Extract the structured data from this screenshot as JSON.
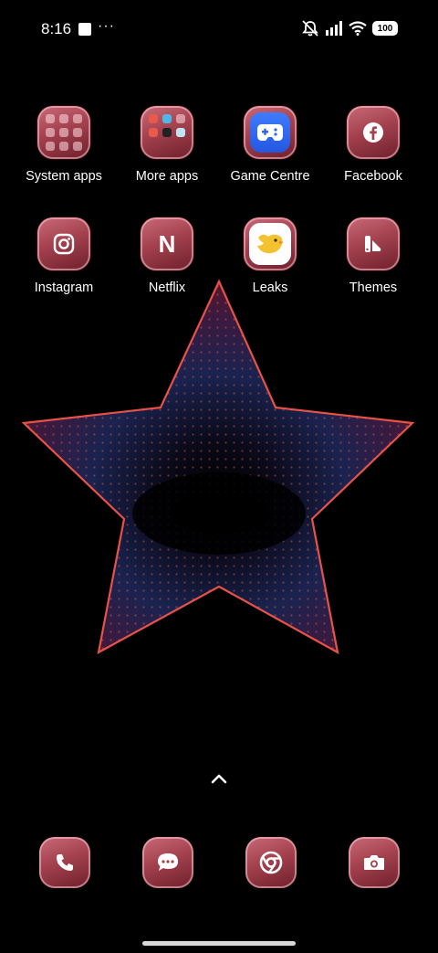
{
  "status_bar": {
    "time": "8:16",
    "more": "···",
    "battery": "100",
    "icons": [
      "notification-square-icon",
      "silent-bell-icon",
      "signal-icon",
      "wifi-icon",
      "battery-icon"
    ]
  },
  "apps": [
    {
      "label": "System apps",
      "icon": "folder-icon"
    },
    {
      "label": "More apps",
      "icon": "folder-icon"
    },
    {
      "label": "Game Centre",
      "icon": "gamepad-icon"
    },
    {
      "label": "Facebook",
      "icon": "facebook-icon"
    },
    {
      "label": "Instagram",
      "icon": "instagram-icon"
    },
    {
      "label": "Netflix",
      "icon": "netflix-icon",
      "glyph": "N"
    },
    {
      "label": "Leaks",
      "icon": "bird-icon"
    },
    {
      "label": "Themes",
      "icon": "themes-icon"
    }
  ],
  "dock": [
    {
      "icon": "phone-icon"
    },
    {
      "icon": "messages-icon"
    },
    {
      "icon": "chrome-icon"
    },
    {
      "icon": "camera-icon"
    }
  ],
  "colors": {
    "background": "#000000",
    "icon_tint": "#a4414f",
    "star_edge": "#ff5a4a"
  }
}
